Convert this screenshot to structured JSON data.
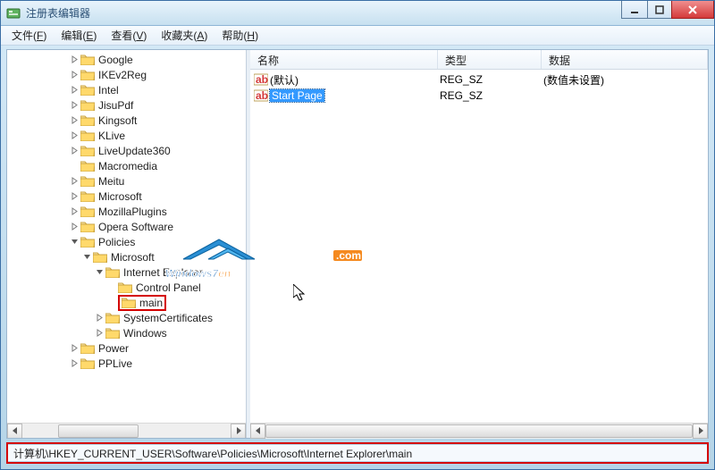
{
  "window": {
    "title": "注册表编辑器"
  },
  "menubar": [
    {
      "label": "文件",
      "key": "F"
    },
    {
      "label": "编辑",
      "key": "E"
    },
    {
      "label": "查看",
      "key": "V"
    },
    {
      "label": "收藏夹",
      "key": "A"
    },
    {
      "label": "帮助",
      "key": "H"
    }
  ],
  "tree": [
    {
      "indent": 5,
      "expander": "right",
      "label": "Google"
    },
    {
      "indent": 5,
      "expander": "right",
      "label": "IKEv2Reg"
    },
    {
      "indent": 5,
      "expander": "right",
      "label": "Intel"
    },
    {
      "indent": 5,
      "expander": "right",
      "label": "JisuPdf"
    },
    {
      "indent": 5,
      "expander": "right",
      "label": "Kingsoft"
    },
    {
      "indent": 5,
      "expander": "right",
      "label": "KLive"
    },
    {
      "indent": 5,
      "expander": "right",
      "label": "LiveUpdate360"
    },
    {
      "indent": 5,
      "expander": "none",
      "label": "Macromedia"
    },
    {
      "indent": 5,
      "expander": "right",
      "label": "Meitu"
    },
    {
      "indent": 5,
      "expander": "right",
      "label": "Microsoft"
    },
    {
      "indent": 5,
      "expander": "right",
      "label": "MozillaPlugins"
    },
    {
      "indent": 5,
      "expander": "right",
      "label": "Opera Software"
    },
    {
      "indent": 5,
      "expander": "down",
      "label": "Policies"
    },
    {
      "indent": 6,
      "expander": "down",
      "label": "Microsoft"
    },
    {
      "indent": 7,
      "expander": "down",
      "label": "Internet Explorer"
    },
    {
      "indent": 8,
      "expander": "none",
      "label": "Control Panel"
    },
    {
      "indent": 8,
      "expander": "none",
      "label": "main",
      "highlight": true
    },
    {
      "indent": 7,
      "expander": "right",
      "label": "SystemCertificates"
    },
    {
      "indent": 7,
      "expander": "right",
      "label": "Windows"
    },
    {
      "indent": 5,
      "expander": "right",
      "label": "Power"
    },
    {
      "indent": 5,
      "expander": "right",
      "label": "PPLive"
    }
  ],
  "columns": {
    "name": "名称",
    "type": "类型",
    "data": "数据"
  },
  "rows": [
    {
      "name": "(默认)",
      "type": "REG_SZ",
      "data": "(数值未设置)",
      "selected": false
    },
    {
      "name": "Start Page",
      "type": "REG_SZ",
      "data": "",
      "selected": true
    }
  ],
  "statusbar": "计算机\\HKEY_CURRENT_USER\\Software\\Policies\\Microsoft\\Internet Explorer\\main",
  "watermark": {
    "text1": "Windows7",
    "text2": "en",
    "domain": ".com"
  }
}
